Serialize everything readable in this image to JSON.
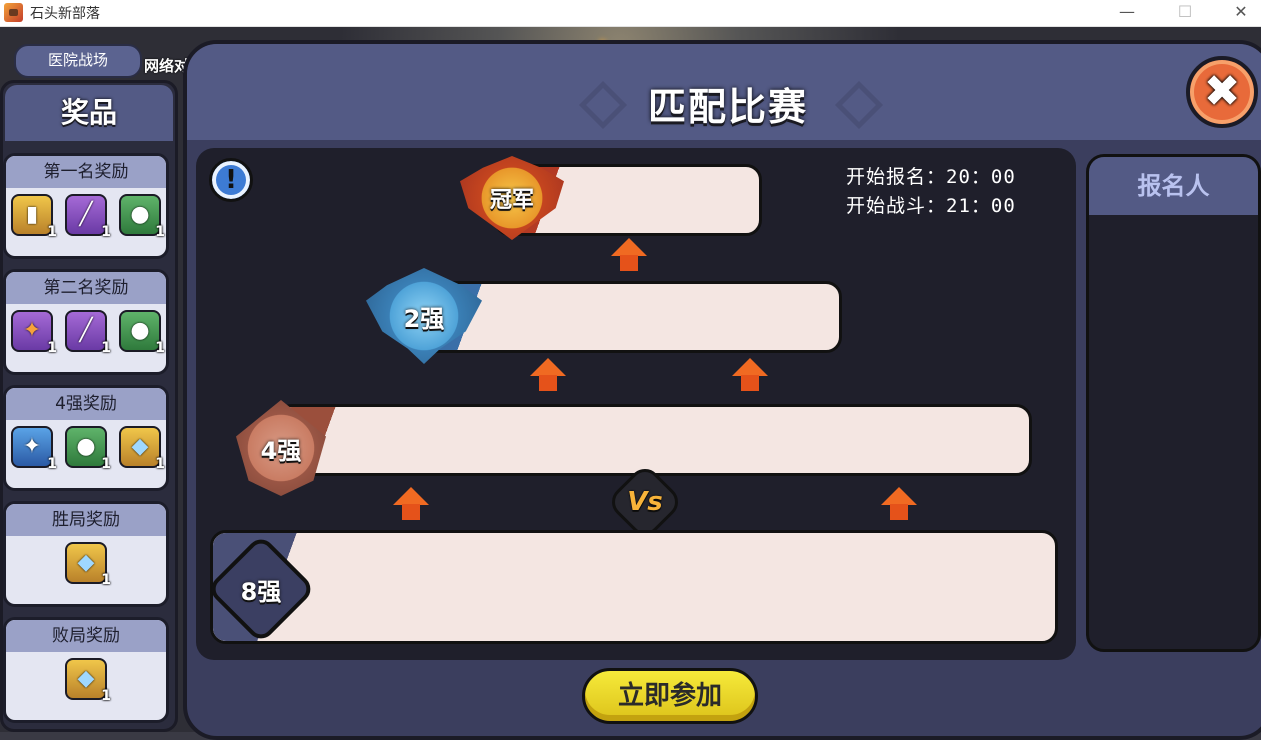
{
  "window": {
    "title": "石头新部落",
    "minimize": "—",
    "maximize": "☐",
    "close": "✕"
  },
  "scene": {
    "tab_label": "医院战场",
    "partial_text": "网络对"
  },
  "prizes": {
    "header": "奖品",
    "groups": [
      {
        "title": "第一名奖励",
        "items": [
          {
            "icon": "gold-cannon-icon",
            "qty": "1"
          },
          {
            "icon": "rifle-icon",
            "qty": "1"
          },
          {
            "icon": "loot-bag-icon",
            "qty": "1"
          }
        ]
      },
      {
        "title": "第二名奖励",
        "items": [
          {
            "icon": "fire-dragon-icon",
            "qty": "1"
          },
          {
            "icon": "rifle-icon",
            "qty": "1"
          },
          {
            "icon": "loot-bag-icon",
            "qty": "1"
          }
        ]
      },
      {
        "title": "4强奖励",
        "items": [
          {
            "icon": "blue-dragon-icon",
            "qty": "1"
          },
          {
            "icon": "loot-bag-icon",
            "qty": "1"
          },
          {
            "icon": "diamond-icon",
            "qty": "1"
          }
        ]
      },
      {
        "title": "胜局奖励",
        "items": [
          {
            "icon": "diamond-icon",
            "qty": "1"
          }
        ]
      },
      {
        "title": "败局奖励",
        "items": [
          {
            "icon": "diamond-icon",
            "qty": "1"
          }
        ]
      }
    ]
  },
  "match": {
    "title": "匹配比赛",
    "signup_start": "开始报名：20：00",
    "battle_start": "开始战斗：21：00",
    "tiers": {
      "champion": "冠军",
      "top2": "2强",
      "top4": "4强",
      "top8": "8强"
    },
    "vs": "Vs",
    "join_button": "立即参加",
    "info_symbol": "!",
    "close_symbol": "✖"
  },
  "signup": {
    "header": "报名人"
  },
  "colors": {
    "panel": "#3b3e5e",
    "header": "#535a85",
    "bar_fill": "#f4e6e2",
    "arrow": "#f06a22",
    "join_button": "#f6ea3a"
  }
}
